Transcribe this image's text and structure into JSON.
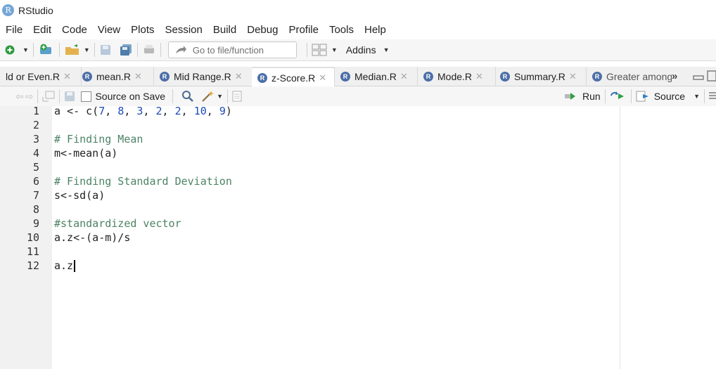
{
  "window": {
    "title": "RStudio",
    "icon": "R"
  },
  "menu": [
    "File",
    "Edit",
    "Code",
    "View",
    "Plots",
    "Session",
    "Build",
    "Debug",
    "Profile",
    "Tools",
    "Help"
  ],
  "toolbar": {
    "goto_placeholder": "Go to file/function",
    "addins_label": "Addins"
  },
  "tabs": [
    {
      "label": "ld or Even.R",
      "active": false
    },
    {
      "label": "mean.R",
      "active": false
    },
    {
      "label": "Mid Range.R",
      "active": false
    },
    {
      "label": "z-Score.R",
      "active": true
    },
    {
      "label": "Median.R",
      "active": false
    },
    {
      "label": "Mode.R",
      "active": false
    },
    {
      "label": "Summary.R",
      "active": false
    },
    {
      "label": "Greater among",
      "active": false
    }
  ],
  "editor_toolbar": {
    "source_on_save_label": "Source on Save",
    "run_label": "Run",
    "source_label": "Source"
  },
  "editor": {
    "lines": [
      {
        "n": "1",
        "text": "a <- c(7, 8, 3, 2, 2, 10, 9)"
      },
      {
        "n": "2",
        "text": ""
      },
      {
        "n": "3",
        "text": "# Finding Mean"
      },
      {
        "n": "4",
        "text": "m<-mean(a)"
      },
      {
        "n": "5",
        "text": ""
      },
      {
        "n": "6",
        "text": "# Finding Standard Deviation"
      },
      {
        "n": "7",
        "text": "s<-sd(a)"
      },
      {
        "n": "8",
        "text": ""
      },
      {
        "n": "9",
        "text": "#standardized vector"
      },
      {
        "n": "10",
        "text": "a.z<-(a-m)/s"
      },
      {
        "n": "11",
        "text": ""
      },
      {
        "n": "12",
        "text": "a.z"
      }
    ]
  },
  "colors": {
    "number": "#1b4bb9",
    "comment": "#4c8363",
    "text": "#333333"
  }
}
